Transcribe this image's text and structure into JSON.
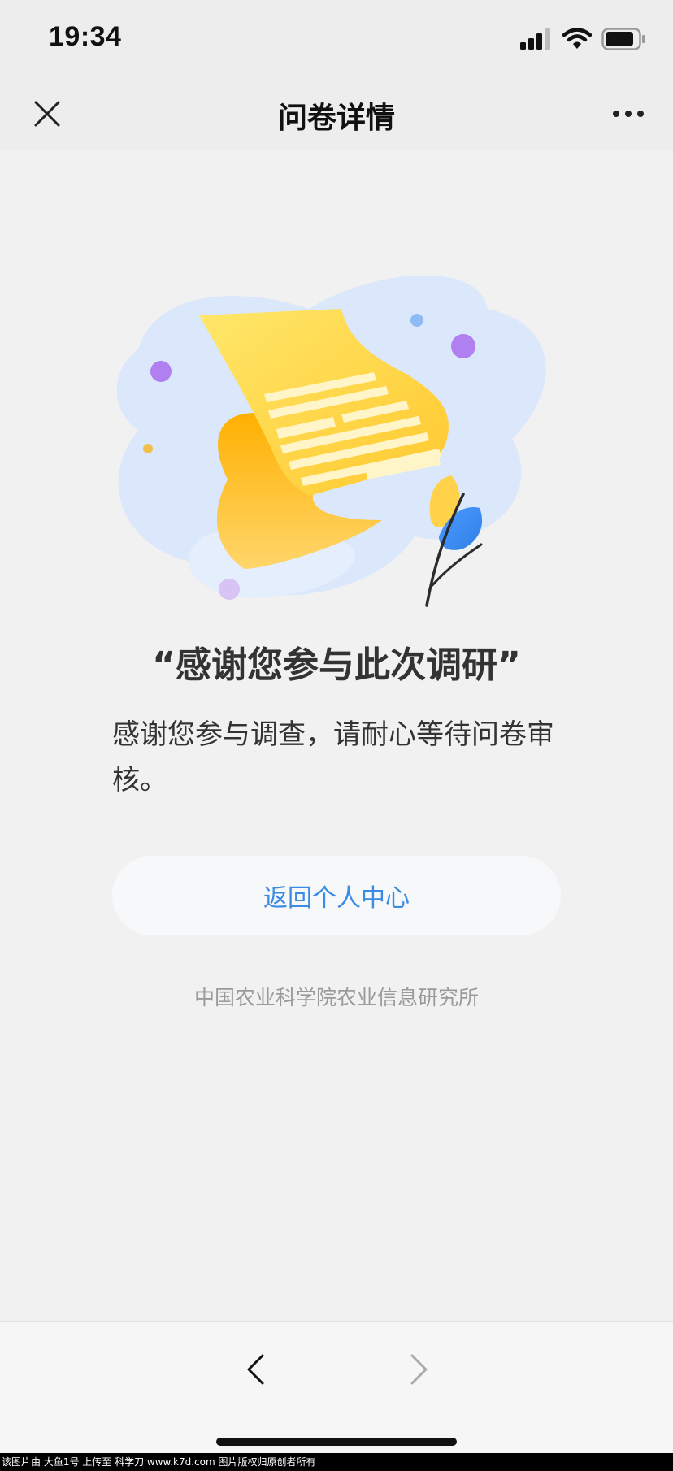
{
  "status_bar": {
    "time": "19:34",
    "icons": [
      "cellular-signal-icon",
      "wifi-icon",
      "battery-icon"
    ]
  },
  "nav": {
    "title": "问卷详情",
    "close_icon": "close-icon",
    "more_icon": "more-icon"
  },
  "main": {
    "illustration": "survey-scroll-illustration",
    "title": "“感谢您参与此次调研”",
    "description": "感谢您参与调查，请耐心等待问卷审核。",
    "back_button_label": "返回个人中心",
    "organization": "中国农业科学院农业信息研究所"
  },
  "toolbar": {
    "back_icon": "chevron-left-icon",
    "forward_icon": "chevron-right-icon"
  },
  "watermark": {
    "text": "该图片由 大鱼1号 上传至 科学刀 www.k7d.com 图片版权归原创者所有"
  },
  "colors": {
    "accent": "#3a8be4",
    "background": "#f1f1f1",
    "bar": "#ededed",
    "scroll_yellow": "#ffd84a",
    "scroll_orange": "#ffb21a"
  }
}
